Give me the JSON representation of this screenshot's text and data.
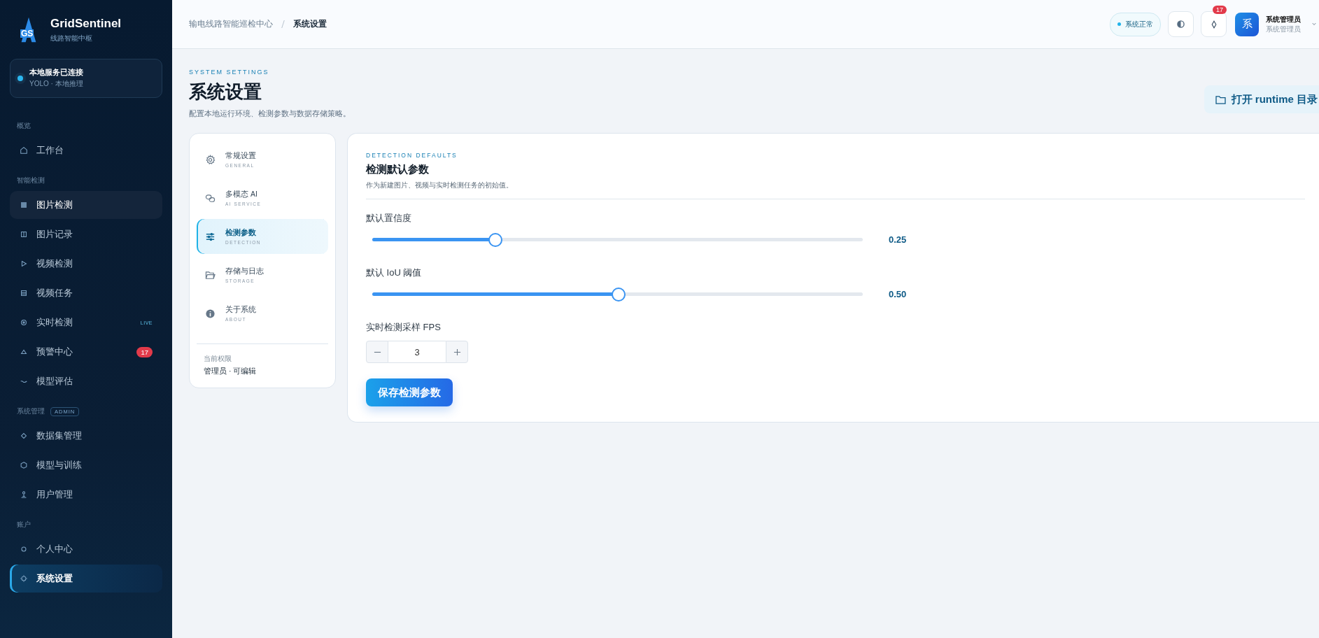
{
  "brand": {
    "logo_mark": "GS",
    "name": "GridSentinel",
    "tagline": "线路智能中枢"
  },
  "service": {
    "title": "本地服务已连接",
    "subtitle": "YOLO · 本地推理",
    "online": true
  },
  "sidebar": {
    "sections": [
      {
        "title": "概览",
        "items": [
          {
            "label": "工作台",
            "selected": false,
            "hovered": false
          }
        ]
      },
      {
        "title": "智能检测",
        "items": [
          {
            "label": "图片检测",
            "selected": false,
            "hovered": true
          },
          {
            "label": "图片记录",
            "selected": false,
            "hovered": false
          },
          {
            "label": "视频检测",
            "selected": false,
            "hovered": false
          },
          {
            "label": "视频任务",
            "selected": false,
            "hovered": false
          },
          {
            "label": "实时检测",
            "selected": false,
            "hovered": false,
            "tag": "LIVE"
          },
          {
            "label": "预警中心",
            "selected": false,
            "hovered": false,
            "badge": "17"
          },
          {
            "label": "模型评估",
            "selected": false,
            "hovered": false
          }
        ]
      },
      {
        "title": "系统管理",
        "tag": "ADMIN",
        "items": [
          {
            "label": "数据集管理",
            "selected": false,
            "hovered": false
          },
          {
            "label": "模型与训练",
            "selected": false,
            "hovered": false
          },
          {
            "label": "用户管理",
            "selected": false,
            "hovered": false
          }
        ]
      },
      {
        "title": "账户",
        "items": [
          {
            "label": "个人中心",
            "selected": false,
            "hovered": false
          },
          {
            "label": "系统设置",
            "selected": true,
            "hovered": false
          }
        ]
      }
    ]
  },
  "header": {
    "breadcrumb": [
      "输电线路智能巡检中心",
      "系统设置"
    ],
    "status": "系统正常",
    "notifications": "17",
    "avatar": "系",
    "user_name": "系统管理员",
    "user_role": "系统管理员"
  },
  "page": {
    "eyebrow": "SYSTEM SETTINGS",
    "title": "系统设置",
    "description": "配置本地运行环境、检测参数与数据存储策略。",
    "action": "打开 runtime 目录"
  },
  "settings_nav": {
    "items": [
      {
        "label": "常规设置",
        "sublabel": "GENERAL",
        "selected": false
      },
      {
        "label": "多模态 AI",
        "sublabel": "AI SERVICE",
        "selected": false
      },
      {
        "label": "检测参数",
        "sublabel": "DETECTION",
        "selected": true
      },
      {
        "label": "存储与日志",
        "sublabel": "STORAGE",
        "selected": false
      },
      {
        "label": "关于系统",
        "sublabel": "ABOUT",
        "selected": false
      }
    ],
    "permission_label": "当前权限",
    "permission": "管理员 · 可编辑"
  },
  "panel": {
    "eyebrow": "DETECTION DEFAULTS",
    "title": "检测默认参数",
    "description": "作为新建图片、视频与实时检测任务的初始值。",
    "sliders": [
      {
        "label": "默认置信度",
        "level": 0.25,
        "reading": "0.25"
      },
      {
        "label": "默认 IoU 阈值",
        "level": 0.5,
        "reading": "0.50"
      }
    ],
    "fps": {
      "label": "实时检测采样 FPS",
      "value": "3"
    },
    "save": "保存检测参数"
  }
}
